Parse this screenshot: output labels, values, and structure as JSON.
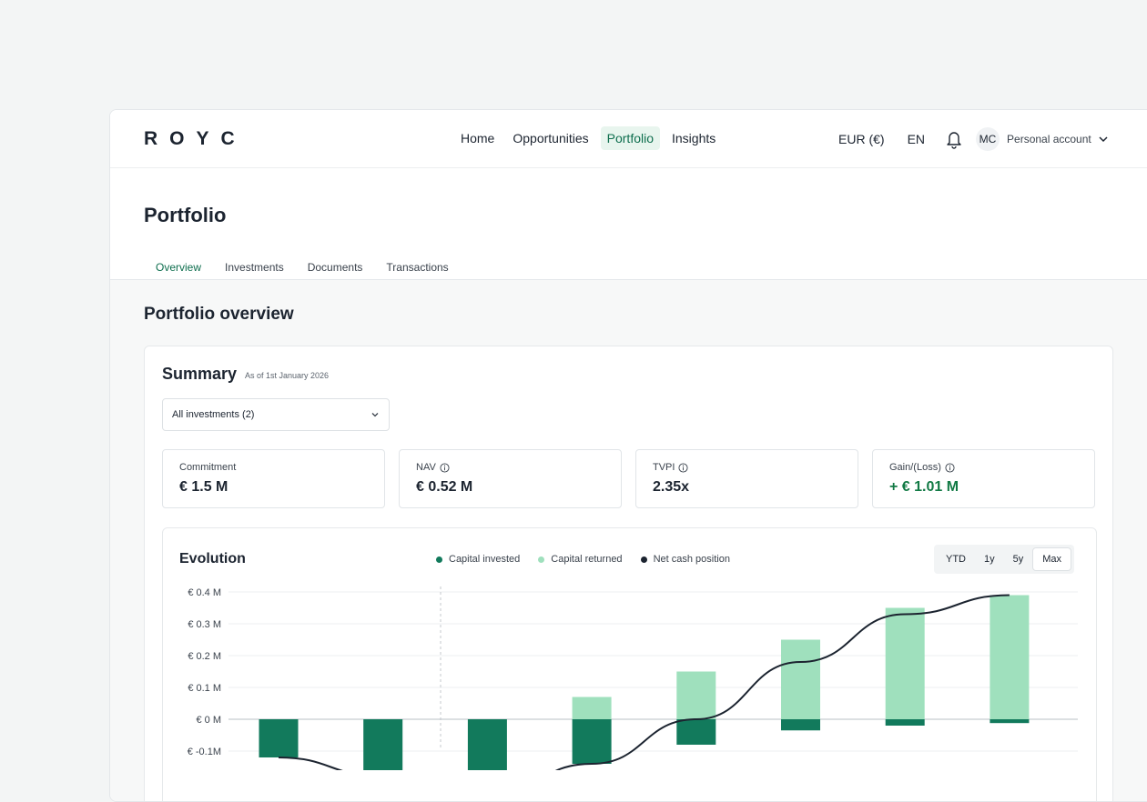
{
  "app": {
    "logo": "ROYC",
    "nav": [
      "Home",
      "Opportunities",
      "Portfolio",
      "Insights"
    ],
    "active_nav": "Portfolio",
    "currency": "EUR (€)",
    "language": "EN",
    "avatar_initials": "MC",
    "account": "Personal account"
  },
  "page": {
    "title": "Portfolio",
    "tabs": [
      "Overview",
      "Investments",
      "Documents",
      "Transactions"
    ],
    "active_tab": "Overview",
    "section_title": "Portfolio overview"
  },
  "summary": {
    "title": "Summary",
    "as_of": "As of 1st January 2026",
    "filter": "All investments (2)",
    "kpis": [
      {
        "label": "Commitment",
        "value": "€ 1.5 M"
      },
      {
        "label": "NAV",
        "value": "€ 0.52 M"
      },
      {
        "label": "TVPI",
        "value": "2.35x"
      },
      {
        "label": "Gain/(Loss)",
        "value": "+ € 1.01 M"
      }
    ]
  },
  "evolution": {
    "title": "Evolution",
    "legend": [
      "Capital invested",
      "Capital returned",
      "Net cash position"
    ],
    "ranges": [
      "YTD",
      "1y",
      "5y",
      "Max"
    ],
    "active_range": "Max"
  },
  "colors": {
    "accent": "#0e6e4e",
    "invested": "#127a5c",
    "returned": "#9fe0bd",
    "net": "#1c2430",
    "gain": "#127a45"
  },
  "chart_data": {
    "type": "bar",
    "y_ticks": [
      "€ 0.4 M",
      "€ 0.3 M",
      "€ 0.2 M",
      "€ 0.1 M",
      "€ 0 M",
      "€ -0.1M"
    ],
    "ylim": [
      -0.2,
      0.4
    ],
    "series": [
      {
        "name": "Capital invested",
        "values": [
          -0.12,
          -0.2,
          -0.2,
          -0.14,
          -0.08,
          -0.035,
          -0.02,
          -0.012
        ]
      },
      {
        "name": "Capital returned",
        "values": [
          0,
          0,
          0,
          0.07,
          0.15,
          0.25,
          0.35,
          0.39
        ]
      },
      {
        "name": "Net cash position",
        "values": [
          -0.12,
          -0.18,
          -0.24,
          -0.14,
          0.0,
          0.18,
          0.33,
          0.39
        ]
      }
    ]
  }
}
